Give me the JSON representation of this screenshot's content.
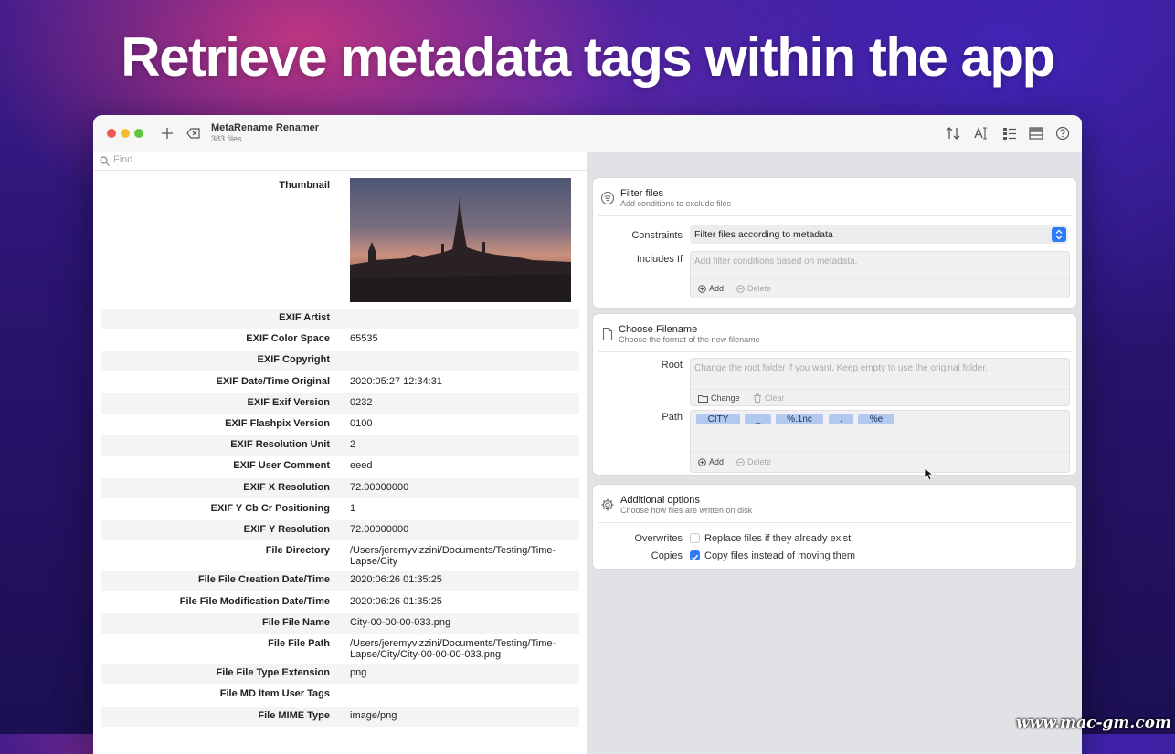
{
  "headline": "Retrieve metadata tags within the app",
  "watermark": "www.mac-gm.com",
  "window": {
    "title": "MetaRename Renamer",
    "subtitle": "383 files",
    "toolbar_icons": [
      "add-icon",
      "delete-icon",
      "sort-icon",
      "text-format-icon",
      "list-icon",
      "table-icon",
      "help-icon"
    ]
  },
  "find": {
    "placeholder": "Find"
  },
  "metadata": {
    "thumbnail_label": "Thumbnail",
    "rows": [
      {
        "key": "EXIF Artist",
        "value": ""
      },
      {
        "key": "EXIF Color Space",
        "value": "65535"
      },
      {
        "key": "EXIF Copyright",
        "value": ""
      },
      {
        "key": "EXIF Date/Time Original",
        "value": "2020:05:27 12:34:31"
      },
      {
        "key": "EXIF Exif Version",
        "value": "0232"
      },
      {
        "key": "EXIF Flashpix Version",
        "value": "0100"
      },
      {
        "key": "EXIF Resolution Unit",
        "value": "2"
      },
      {
        "key": "EXIF User Comment",
        "value": "eeed"
      },
      {
        "key": "EXIF X Resolution",
        "value": "72.00000000"
      },
      {
        "key": "EXIF Y Cb Cr Positioning",
        "value": "1"
      },
      {
        "key": "EXIF Y Resolution",
        "value": "72.00000000"
      },
      {
        "key": "File Directory",
        "value": "/Users/jeremyvizzini/Documents/Testing/Time-Lapse/City"
      },
      {
        "key": "File File Creation Date/Time",
        "value": "2020:06:26 01:35:25"
      },
      {
        "key": "File File Modification Date/Time",
        "value": "2020:06:26 01:35:25"
      },
      {
        "key": "File File Name",
        "value": "City-00-00-00-033.png"
      },
      {
        "key": "File File Path",
        "value": "/Users/jeremyvizzini/Documents/Testing/Time-Lapse/City/City-00-00-00-033.png"
      },
      {
        "key": "File File Type Extension",
        "value": "png"
      },
      {
        "key": "File MD Item User Tags",
        "value": ""
      },
      {
        "key": "File MIME Type",
        "value": "image/png"
      }
    ]
  },
  "filter": {
    "title": "Filter files",
    "subtitle": "Add conditions to exclude files",
    "constraints_label": "Constraints",
    "constraints_value": "Filter files according to metadata",
    "includes_label": "Includes If",
    "includes_placeholder": "Add filter conditions based on metadata.",
    "add_label": "Add",
    "delete_label": "Delete"
  },
  "filename": {
    "title": "Choose Filename",
    "subtitle": "Choose the format of the new filename",
    "root_label": "Root",
    "root_placeholder": "Change the root folder if you want. Keep empty to use the original folder.",
    "change_label": "Change",
    "clear_label": "Clear",
    "path_label": "Path",
    "tokens": [
      "CITY",
      "_",
      "%.1nc",
      ".",
      "%e"
    ],
    "add_label": "Add",
    "delete_label": "Delete"
  },
  "options": {
    "title": "Additional options",
    "subtitle": "Choose how files are written on disk",
    "overwrites_label": "Overwrites",
    "overwrites_text": "Replace files if they already exist",
    "overwrites_checked": false,
    "copies_label": "Copies",
    "copies_text": "Copy files instead of moving them",
    "copies_checked": true
  },
  "colors": {
    "accent": "#2f7bf5",
    "token_bg": "#b3c8ee",
    "close": "#ee5a52",
    "minimize": "#f5bd2e",
    "zoom": "#5ec541"
  }
}
